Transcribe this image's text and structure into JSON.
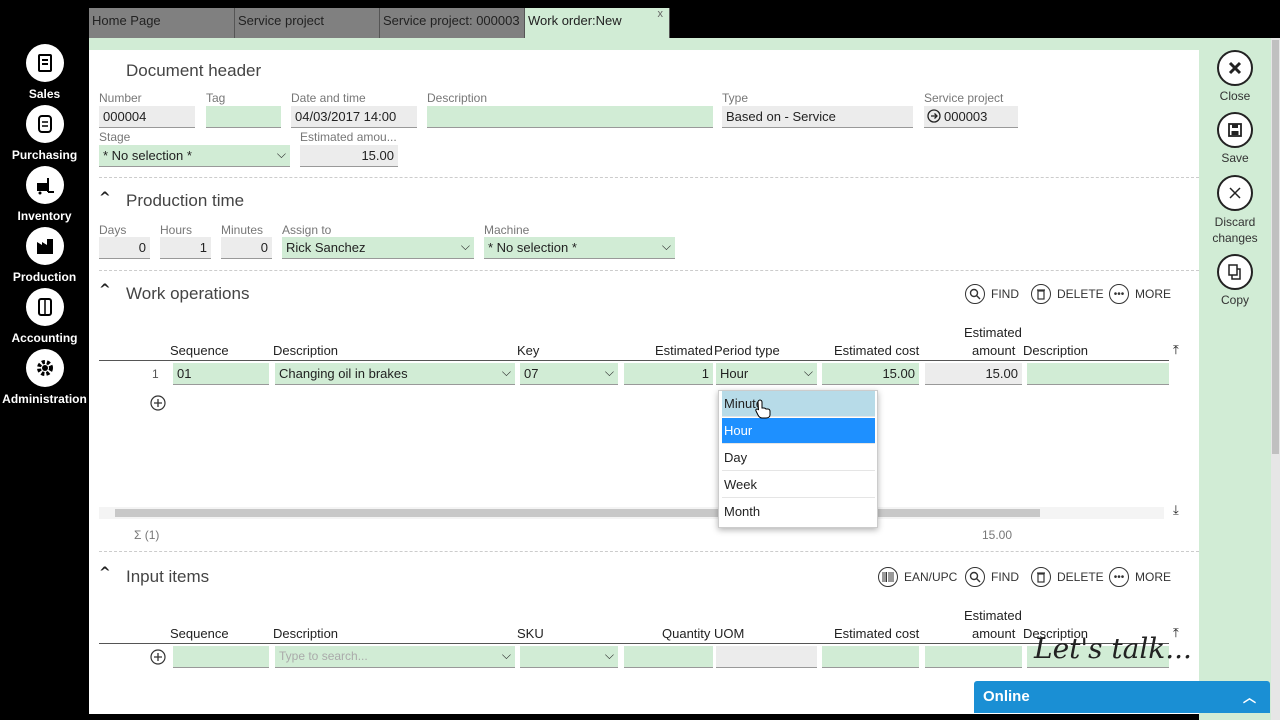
{
  "nav": [
    {
      "label": "Sales",
      "icon": "sales-icon"
    },
    {
      "label": "Purchasing",
      "icon": "purchasing-icon"
    },
    {
      "label": "Inventory",
      "icon": "inventory-icon"
    },
    {
      "label": "Production",
      "icon": "production-icon"
    },
    {
      "label": "Accounting",
      "icon": "accounting-icon"
    },
    {
      "label": "Administration",
      "icon": "gear-icon"
    }
  ],
  "tabs": [
    {
      "label": "Home Page"
    },
    {
      "label": "Service project"
    },
    {
      "label": "Service project: 000003"
    },
    {
      "label": "Work order:New",
      "close": "x"
    }
  ],
  "header": {
    "title": "Document header",
    "number_label": "Number",
    "number": "000004",
    "tag_label": "Tag",
    "tag": "",
    "date_label": "Date and time",
    "date": "04/03/2017 14:00",
    "desc_label": "Description",
    "desc": "",
    "type_label": "Type",
    "type": "Based on - Service",
    "project_label": "Service project",
    "project": "000003",
    "stage_label": "Stage",
    "stage": "* No selection *",
    "estamount_label": "Estimated amou...",
    "estamount": "15.00"
  },
  "production": {
    "title": "Production time",
    "days_label": "Days",
    "days": "0",
    "hours_label": "Hours",
    "hours": "1",
    "minutes_label": "Minutes",
    "minutes": "0",
    "assign_label": "Assign to",
    "assign": "Rick Sanchez",
    "machine_label": "Machine",
    "machine": "* No selection *"
  },
  "workops": {
    "title": "Work operations",
    "find": "FIND",
    "delete": "DELETE",
    "more": "MORE",
    "columns": {
      "sequence": "Sequence",
      "description": "Description",
      "key": "Key",
      "estimated": "Estimated",
      "period": "Period type",
      "estcost": "Estimated cost",
      "estamount1": "Estimated",
      "estamount2": "amount",
      "desc2": "Description"
    },
    "row": {
      "num": "1",
      "sequence": "01",
      "description": "Changing oil in brakes",
      "key": "07",
      "estimated": "1",
      "period": "Hour",
      "estcost": "15.00",
      "estamount": "15.00"
    },
    "sum_label": "Σ (1)",
    "sum_value": "15.00"
  },
  "period_options": [
    "Minute",
    "Hour",
    "Day",
    "Week",
    "Month"
  ],
  "inputitems": {
    "title": "Input items",
    "ean": "EAN/UPC",
    "find": "FIND",
    "delete": "DELETE",
    "more": "MORE",
    "columns": {
      "sequence": "Sequence",
      "description": "Description",
      "sku": "SKU",
      "quantity": "Quantity",
      "uom": "UOM",
      "estcost": "Estimated cost",
      "estamount1": "Estimated",
      "estamount2": "amount",
      "desc2": "Description"
    },
    "search_placeholder": "Type to search..."
  },
  "actions": [
    {
      "label": "Close",
      "icon": "close-icon"
    },
    {
      "label": "Save",
      "icon": "save-icon"
    },
    {
      "label": "Discard changes",
      "icon": "discard-icon"
    },
    {
      "label": "Copy",
      "icon": "copy-icon"
    }
  ],
  "chat": {
    "online": "Online",
    "letstalk": "Let's talk..."
  }
}
